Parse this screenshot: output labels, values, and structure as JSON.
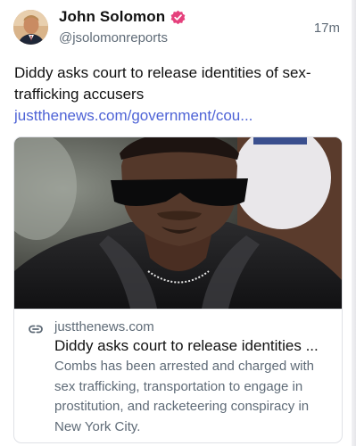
{
  "post": {
    "author_name": "John Solomon",
    "handle": "@jsolomonreports",
    "timestamp": "17m",
    "text": "Diddy asks court to release identities of sex-trafficking accusers ",
    "link_text": "justthenews.com/government/cou...",
    "verified_icon": "verified-badge-icon"
  },
  "link_card": {
    "domain": "justthenews.com",
    "title": "Diddy asks court to release identities ...",
    "description": "Combs has been arrested and charged with sex trafficking, transportation to engage in prostitution, and racketeering conspiracy in New York City.",
    "link_icon": "link-icon"
  },
  "colors": {
    "link": "#4e63d6",
    "verified_badge": "#e5407c",
    "secondary_text": "#5f6b77"
  }
}
